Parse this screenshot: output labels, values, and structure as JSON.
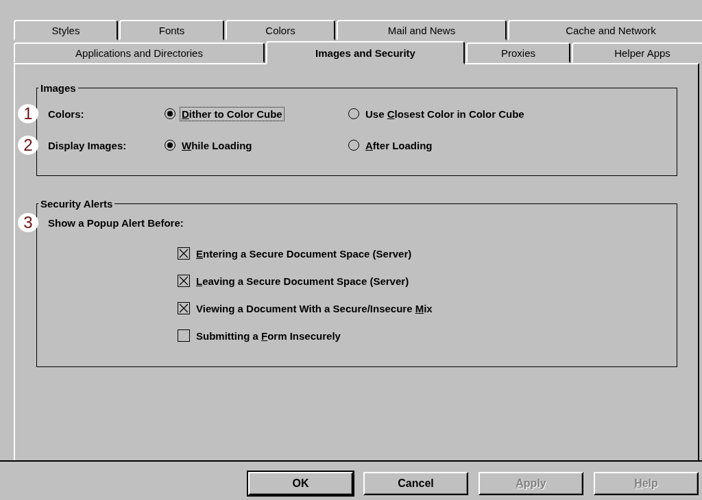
{
  "tab_rows": [
    [
      {
        "label": "Styles",
        "selected": false
      },
      {
        "label": "Fonts",
        "selected": false
      },
      {
        "label": "Colors",
        "selected": false
      },
      {
        "label": "Mail and News",
        "selected": false
      },
      {
        "label": "Cache and Network",
        "selected": false
      }
    ],
    [
      {
        "label": "Applications and Directories",
        "selected": false
      },
      {
        "label": "Images and Security",
        "selected": true
      },
      {
        "label": "Proxies",
        "selected": false
      },
      {
        "label": "Helper Apps",
        "selected": false
      }
    ]
  ],
  "images_group": {
    "title": "Images",
    "rows": [
      {
        "callout": "1",
        "label": "Colors:",
        "options": [
          {
            "key": "D",
            "after": "ither to Color Cube",
            "selected": true,
            "focused": true
          },
          {
            "before": "Use ",
            "key": "C",
            "after": "losest Color in Color Cube",
            "selected": false,
            "focused": false
          }
        ]
      },
      {
        "callout": "2",
        "label": "Display Images:",
        "options": [
          {
            "key": "W",
            "after": "hile Loading",
            "selected": true,
            "focused": false
          },
          {
            "key": "A",
            "after": "fter Loading",
            "selected": false,
            "focused": false
          }
        ]
      }
    ]
  },
  "security_group": {
    "title": "Security Alerts",
    "callout": "3",
    "prompt": "Show a Popup Alert Before:",
    "checkboxes": [
      {
        "key": "E",
        "after": "ntering a Secure Document Space (Server)",
        "checked": true
      },
      {
        "key": "L",
        "after": "eaving a Secure Document Space (Server)",
        "checked": true
      },
      {
        "before": "Viewing a Document With a Secure/Insecure ",
        "key": "M",
        "after": "ix",
        "checked": true
      },
      {
        "before": "Submitting a ",
        "key": "F",
        "after": "orm Insecurely",
        "checked": false
      }
    ]
  },
  "buttons": [
    {
      "after": "OK",
      "default": true,
      "disabled": false
    },
    {
      "after": "Cancel",
      "default": false,
      "disabled": false
    },
    {
      "key": "A",
      "after": "pply",
      "default": false,
      "disabled": true
    },
    {
      "key": "H",
      "after": "elp",
      "default": false,
      "disabled": true
    }
  ]
}
